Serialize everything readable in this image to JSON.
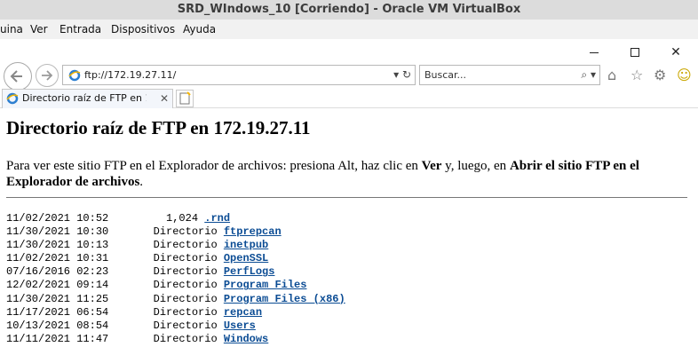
{
  "vbox": {
    "title": "SRD_WIndows_10 [Corriendo] - Oracle VM VirtualBox",
    "menu": [
      "uina",
      "Ver",
      "Entrada",
      "Dispositivos",
      "Ayuda"
    ]
  },
  "browser": {
    "window_controls": {
      "minimize": "minimize",
      "maximize": "maximize",
      "close": "✕"
    },
    "address": "ftp://172.19.27.11/",
    "search_placeholder": "Buscar...",
    "tab": {
      "title": "Directorio raíz de FTP en 17..."
    }
  },
  "page": {
    "title": "Directorio raíz de FTP en 172.19.27.11",
    "intro_pre": "Para ver este sitio FTP en el Explorador de archivos: presiona Alt, haz clic en ",
    "intro_bold1": "Ver",
    "intro_mid": " y, luego, en ",
    "intro_bold2": "Abrir el sitio FTP en el Explorador de archivos",
    "intro_end": ".",
    "entries": [
      {
        "prefix": "11/02/2021 10:52         1,024 ",
        "name": ".rnd"
      },
      {
        "prefix": "11/30/2021 10:30       Directorio ",
        "name": "ftprepcan"
      },
      {
        "prefix": "11/30/2021 10:13       Directorio ",
        "name": "inetpub"
      },
      {
        "prefix": "11/02/2021 10:31       Directorio ",
        "name": "OpenSSL"
      },
      {
        "prefix": "07/16/2016 02:23       Directorio ",
        "name": "PerfLogs"
      },
      {
        "prefix": "12/02/2021 09:14       Directorio ",
        "name": "Program Files"
      },
      {
        "prefix": "11/30/2021 11:25       Directorio ",
        "name": "Program Files (x86)"
      },
      {
        "prefix": "11/17/2021 06:54       Directorio ",
        "name": "repcan"
      },
      {
        "prefix": "10/13/2021 08:54       Directorio ",
        "name": "Users"
      },
      {
        "prefix": "11/11/2021 11:47       Directorio ",
        "name": "Windows"
      }
    ]
  }
}
